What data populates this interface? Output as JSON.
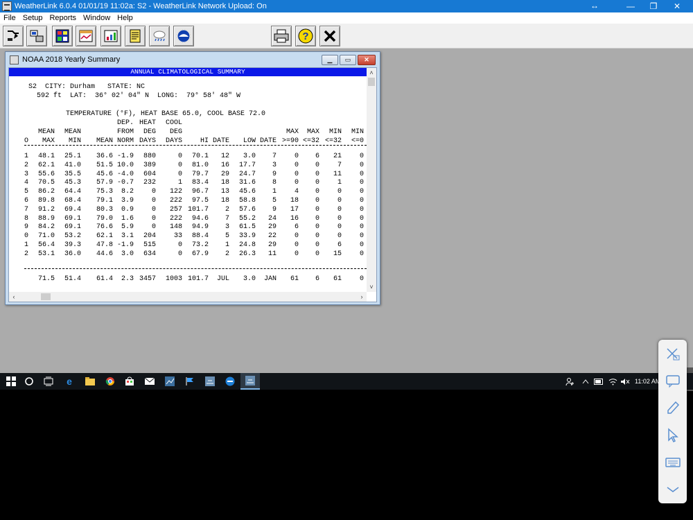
{
  "app": {
    "title": "WeatherLink 6.0.4  01/01/19  11:02a: S2 - WeatherLink Network Upload: On",
    "resize_glyph": "↔",
    "minimize": "—",
    "restore": "❐",
    "close": "✕"
  },
  "menu": [
    "File",
    "Setup",
    "Reports",
    "Window",
    "Help"
  ],
  "toolbar": {
    "icons": [
      "select-station-icon",
      "connect-station-icon",
      "bulletin-icon",
      "summary-icon",
      "plot-icon",
      "noaa-notes-icon",
      "weather-icon",
      "noaa-logo-icon",
      "print-icon",
      "help-icon",
      "close-icon"
    ]
  },
  "child_window": {
    "title": "NOAA 2018 Yearly Summary",
    "heading": "ANNUAL CLIMATOLOGICAL SUMMARY",
    "station_line": "S2  CITY: Durham   STATE: NC",
    "location_line": "592 ft  LAT:  36° 02' 04\" N  LONG:  79° 58' 48\" W",
    "section_title": "TEMPERATURE (°F), HEAT BASE 65.0, COOL BASE 72.0",
    "header_rows": [
      [
        "",
        "",
        "",
        "",
        "DEP.",
        "HEAT",
        "COOL",
        "",
        "",
        "",
        "",
        "",
        "",
        "",
        ""
      ],
      [
        "",
        "MEAN",
        "MEAN",
        "",
        "FROM",
        "DEG",
        "DEG",
        "",
        "",
        "",
        "",
        "MAX",
        "MAX",
        "MIN",
        "MIN"
      ],
      [
        "O",
        "MAX",
        "MIN",
        "MEAN",
        "NORM",
        "DAYS",
        "DAYS",
        "HI",
        "DATE",
        "LOW",
        "DATE",
        ">=90",
        "<=32",
        "<=32",
        "<=0"
      ]
    ],
    "rows": [
      [
        "1",
        "48.1",
        "25.1",
        "36.6",
        "-1.9",
        "880",
        "0",
        "70.1",
        "12",
        "3.0",
        "7",
        "0",
        "6",
        "21",
        "0"
      ],
      [
        "2",
        "62.1",
        "41.0",
        "51.5",
        "10.0",
        "389",
        "0",
        "81.0",
        "16",
        "17.7",
        "3",
        "0",
        "0",
        "7",
        "0"
      ],
      [
        "3",
        "55.6",
        "35.5",
        "45.6",
        "-4.0",
        "604",
        "0",
        "79.7",
        "29",
        "24.7",
        "9",
        "0",
        "0",
        "11",
        "0"
      ],
      [
        "4",
        "70.5",
        "45.3",
        "57.9",
        "-0.7",
        "232",
        "1",
        "83.4",
        "18",
        "31.6",
        "8",
        "0",
        "0",
        "1",
        "0"
      ],
      [
        "5",
        "86.2",
        "64.4",
        "75.3",
        "8.2",
        "0",
        "122",
        "96.7",
        "13",
        "45.6",
        "1",
        "4",
        "0",
        "0",
        "0"
      ],
      [
        "6",
        "89.8",
        "68.4",
        "79.1",
        "3.9",
        "0",
        "222",
        "97.5",
        "18",
        "58.8",
        "5",
        "18",
        "0",
        "0",
        "0"
      ],
      [
        "7",
        "91.2",
        "69.4",
        "80.3",
        "0.9",
        "0",
        "257",
        "101.7",
        "2",
        "57.6",
        "9",
        "17",
        "0",
        "0",
        "0"
      ],
      [
        "8",
        "88.9",
        "69.1",
        "79.0",
        "1.6",
        "0",
        "222",
        "94.6",
        "7",
        "55.2",
        "24",
        "16",
        "0",
        "0",
        "0"
      ],
      [
        "9",
        "84.2",
        "69.1",
        "76.6",
        "5.9",
        "0",
        "148",
        "94.9",
        "3",
        "61.5",
        "29",
        "6",
        "0",
        "0",
        "0"
      ],
      [
        "0",
        "71.0",
        "53.2",
        "62.1",
        "3.1",
        "204",
        "33",
        "88.4",
        "5",
        "33.9",
        "22",
        "0",
        "0",
        "0",
        "0"
      ],
      [
        "1",
        "56.4",
        "39.3",
        "47.8",
        "-1.9",
        "515",
        "0",
        "73.2",
        "1",
        "24.8",
        "29",
        "0",
        "0",
        "6",
        "0"
      ],
      [
        "2",
        "53.1",
        "36.0",
        "44.6",
        "3.0",
        "634",
        "0",
        "67.9",
        "2",
        "26.3",
        "11",
        "0",
        "0",
        "15",
        "0"
      ]
    ],
    "totals": [
      "",
      "71.5",
      "51.4",
      "61.4",
      "2.3",
      "3457",
      "1003",
      "101.7",
      "JUL",
      "3.0",
      "JAN",
      "61",
      "6",
      "61",
      "0"
    ],
    "scroll": {
      "up": "˄",
      "down": "˅",
      "left": "‹",
      "right": "›"
    }
  },
  "taskbar": {
    "clock": "11:02 AM",
    "pinned": [
      "windows-start-icon",
      "cortana-icon",
      "task-view-icon",
      "edge-icon",
      "file-explorer-icon",
      "chrome-icon",
      "store-icon",
      "mail-icon",
      "weatherlink-icon",
      "flag-app-icon",
      "weatherlink-2-icon",
      "teamviewer-icon",
      "weatherlink-active-icon"
    ]
  },
  "colors": {
    "titlebar": "#1779d3",
    "heading_bg": "#0b18e8",
    "workspace": "#ababab",
    "taskbar": "#101418"
  }
}
